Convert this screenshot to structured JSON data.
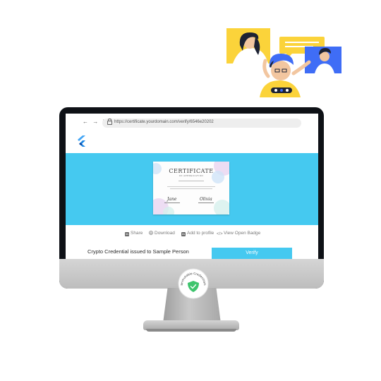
{
  "browser": {
    "nav_icons": "← → ↻",
    "url": "https://certificate.yourdomain.com/verify/6546e20202"
  },
  "certificate": {
    "title": "CERTIFICATE",
    "subtitle": "OF APPRECIATION",
    "signature_left": "Jane Anderson",
    "signature_right": "Olivia Wilson"
  },
  "actions": {
    "share": "Share",
    "download": "Download",
    "add_to_profile": "Add to profile",
    "view_badge": "View Open Badge"
  },
  "credential": {
    "issued_text": "Crypto Credential issued to Sample Person",
    "verify_label": "Verify"
  },
  "badge": {
    "text": "Immutable Credentials"
  },
  "colors": {
    "accent": "#45c9f0",
    "screen_frame": "#0e1116",
    "badge_green": "#3ec46d",
    "illustration_yellow": "#fbd33a",
    "illustration_blue": "#3f6df6"
  }
}
